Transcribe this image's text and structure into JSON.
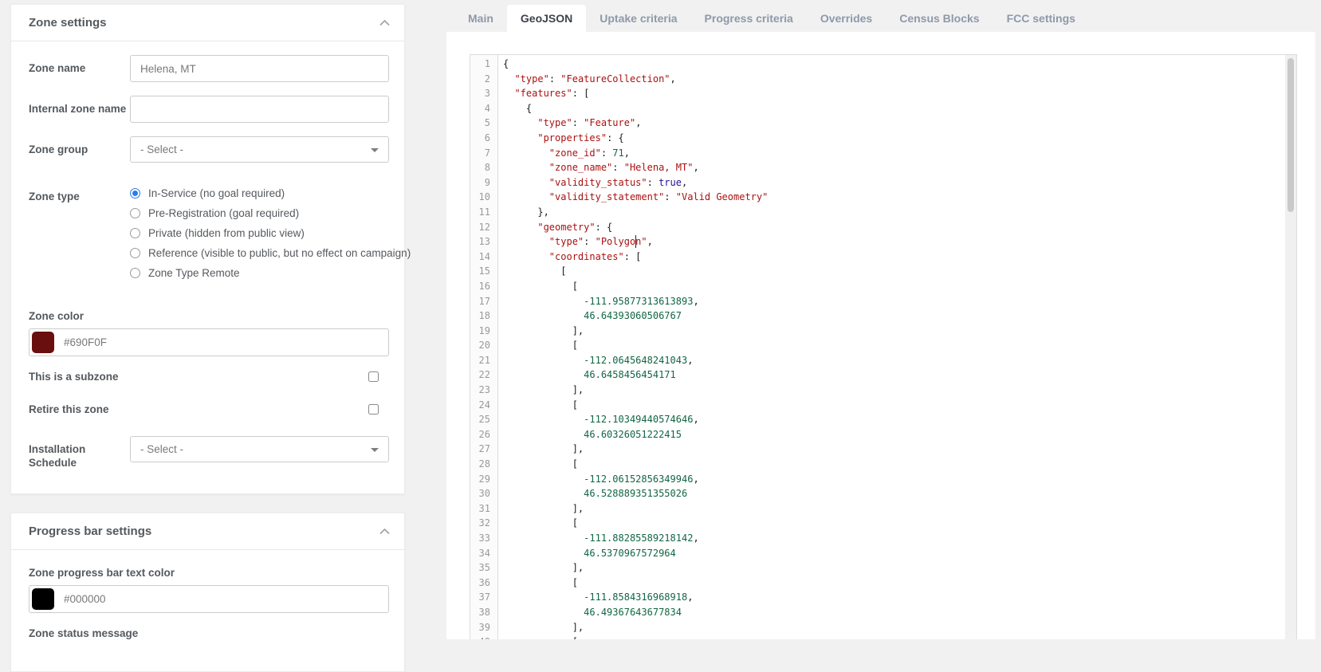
{
  "tabs": [
    {
      "label": "Main",
      "active": false
    },
    {
      "label": "GeoJSON",
      "active": true
    },
    {
      "label": "Uptake criteria",
      "active": false
    },
    {
      "label": "Progress criteria",
      "active": false
    },
    {
      "label": "Overrides",
      "active": false
    },
    {
      "label": "Census Blocks",
      "active": false
    },
    {
      "label": "FCC settings",
      "active": false
    }
  ],
  "zone_settings": {
    "title": "Zone settings",
    "zone_name_label": "Zone name",
    "zone_name_value": "Helena, MT",
    "internal_label": "Internal zone name",
    "internal_value": "",
    "zone_group_label": "Zone group",
    "zone_group_value": "- Select -",
    "zone_type_label": "Zone type",
    "zone_type_options": [
      {
        "label": "In-Service (no goal required)",
        "selected": true
      },
      {
        "label": "Pre-Registration (goal required)",
        "selected": false
      },
      {
        "label": "Private (hidden from public view)",
        "selected": false
      },
      {
        "label": "Reference (visible to public, but no effect on campaign)",
        "selected": false
      },
      {
        "label": "Zone Type Remote",
        "selected": false
      }
    ],
    "zone_color_label": "Zone color",
    "zone_color_value": "#690F0F",
    "subzone_label": "This is a subzone",
    "subzone_checked": false,
    "retire_label": "Retire this zone",
    "retire_checked": false,
    "installation_label": "Installation Schedule",
    "installation_value": "- Select -"
  },
  "progress_settings": {
    "title": "Progress bar settings",
    "text_color_label": "Zone progress bar text color",
    "text_color_value": "#000000",
    "status_message_label": "Zone status message"
  },
  "colors": {
    "zone_color": "#690F0F",
    "progress_text_color": "#000000",
    "accent_blue": "#2b7de9"
  },
  "editor": {
    "language": "json",
    "cursor": {
      "line": 13,
      "ch": 23
    },
    "syntax_colors": {
      "string": "#aa1111",
      "number": "#116644",
      "atom": "#221199",
      "default": "#1b1b1b",
      "line_number": "#999999"
    },
    "lines": [
      "{",
      "  \"type\": \"FeatureCollection\",",
      "  \"features\": [",
      "    {",
      "      \"type\": \"Feature\",",
      "      \"properties\": {",
      "        \"zone_id\": 71,",
      "        \"zone_name\": \"Helena, MT\",",
      "        \"validity_status\": true,",
      "        \"validity_statement\": \"Valid Geometry\"",
      "      },",
      "      \"geometry\": {",
      "        \"type\": \"Polygon\",",
      "        \"coordinates\": [",
      "          [",
      "            [",
      "              -111.95877313613893,",
      "              46.64393060506767",
      "            ],",
      "            [",
      "              -112.0645648241043,",
      "              46.6458456454171",
      "            ],",
      "            [",
      "              -112.10349440574646,",
      "              46.60326051222415",
      "            ],",
      "            [",
      "              -112.06152856349946,",
      "              46.528889351355026",
      "            ],",
      "            [",
      "              -111.88285589218142,",
      "              46.5370967572964",
      "            ],",
      "            [",
      "              -111.8584316968918,",
      "              46.49367643677834",
      "            ],",
      "            ["
    ]
  }
}
